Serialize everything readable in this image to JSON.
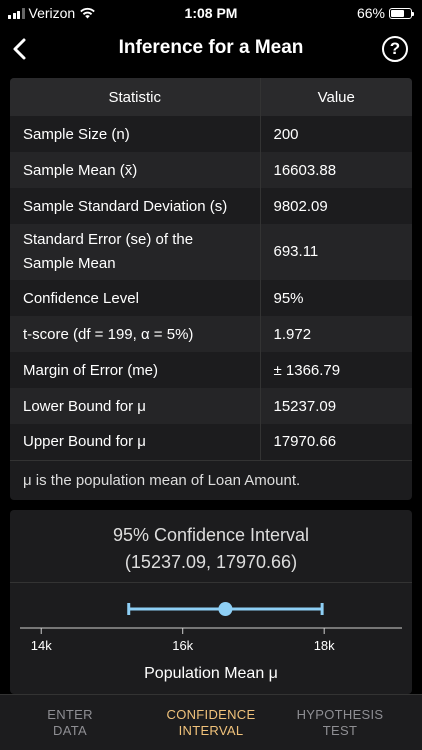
{
  "status": {
    "carrier": "Verizon",
    "time": "1:08 PM",
    "battery": "66%",
    "battery_level": 0.66
  },
  "nav": {
    "title": "Inference for a Mean",
    "help": "?"
  },
  "table": {
    "headers": [
      "Statistic",
      "Value"
    ],
    "rows": [
      {
        "label": "Sample Size (n)",
        "value": "200"
      },
      {
        "label": "Sample Mean (x̄)",
        "value": "16603.88"
      },
      {
        "label": "Sample Standard Deviation (s)",
        "value": "9802.09"
      },
      {
        "label": "Standard Error (se) of the Sample Mean",
        "value": "693.11"
      },
      {
        "label": "Confidence Level",
        "value": "95%"
      },
      {
        "label": "t-score (df = 199, α = 5%)",
        "value": "1.972"
      },
      {
        "label": "Margin of Error (me)",
        "value": "± 1366.79"
      },
      {
        "label": "Lower Bound for μ",
        "value": "15237.09"
      },
      {
        "label": "Upper Bound for μ",
        "value": "17970.66"
      }
    ],
    "note": "μ is the population mean of Loan Amount."
  },
  "ci": {
    "title": "95% Confidence Interval",
    "interval": "(15237.09, 17970.66)",
    "chart_data": {
      "type": "scatter",
      "point": 16603.88,
      "lower": 15237.09,
      "upper": 17970.66,
      "xlim": [
        13700,
        19100
      ],
      "ticks": [
        14000,
        16000,
        18000
      ],
      "tick_labels": [
        "14k",
        "16k",
        "18k"
      ],
      "xlabel": "Population Mean μ",
      "color": "#8ecff5"
    }
  },
  "tabs": {
    "enter": "ENTER\nDATA",
    "ci": "CONFIDENCE\nINTERVAL",
    "hyp": "HYPOTHESIS\nTEST"
  },
  "colors": {
    "accent": "#f0c27b",
    "ci_bar": "#8ecff5",
    "inactive_tab": "#8e8e93"
  }
}
